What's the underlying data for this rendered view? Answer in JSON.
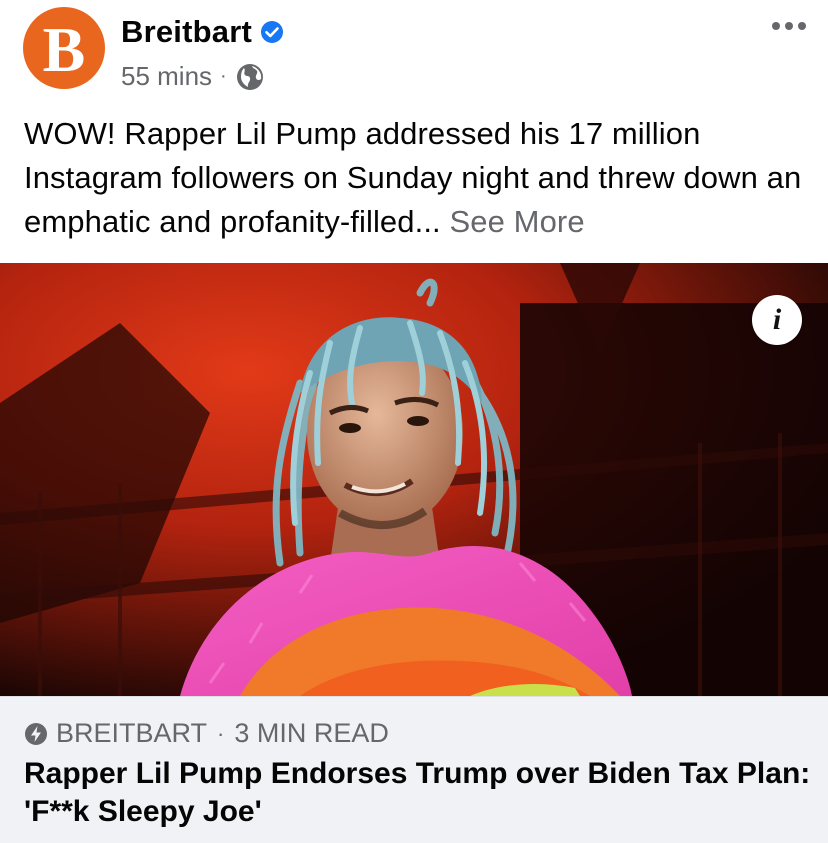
{
  "post": {
    "page_name": "Breitbart",
    "avatar_letter": "B",
    "time": "55 mins",
    "dot": "·",
    "body_text": "WOW! Rapper Lil Pump addressed his 17 million Instagram followers on Sunday night and threw down an emphatic and profanity-filled... ",
    "see_more": "See More",
    "icons": [
      "verified-badge-icon",
      "globe-icon",
      "more-options-icon",
      "info-icon",
      "instant-article-bolt-icon"
    ]
  },
  "media": {
    "info_glyph": "i"
  },
  "link_card": {
    "source": "BREITBART",
    "separator": "·",
    "read_time": "3 MIN READ",
    "title": "Rapper Lil Pump Endorses Trump over Biden Tax Plan: 'F**k Sleepy Joe'"
  },
  "colors": {
    "brand_orange": "#e8661e",
    "verified_blue": "#1877f2",
    "secondary_text": "#65676b",
    "card_bg": "#f0f2f5"
  }
}
